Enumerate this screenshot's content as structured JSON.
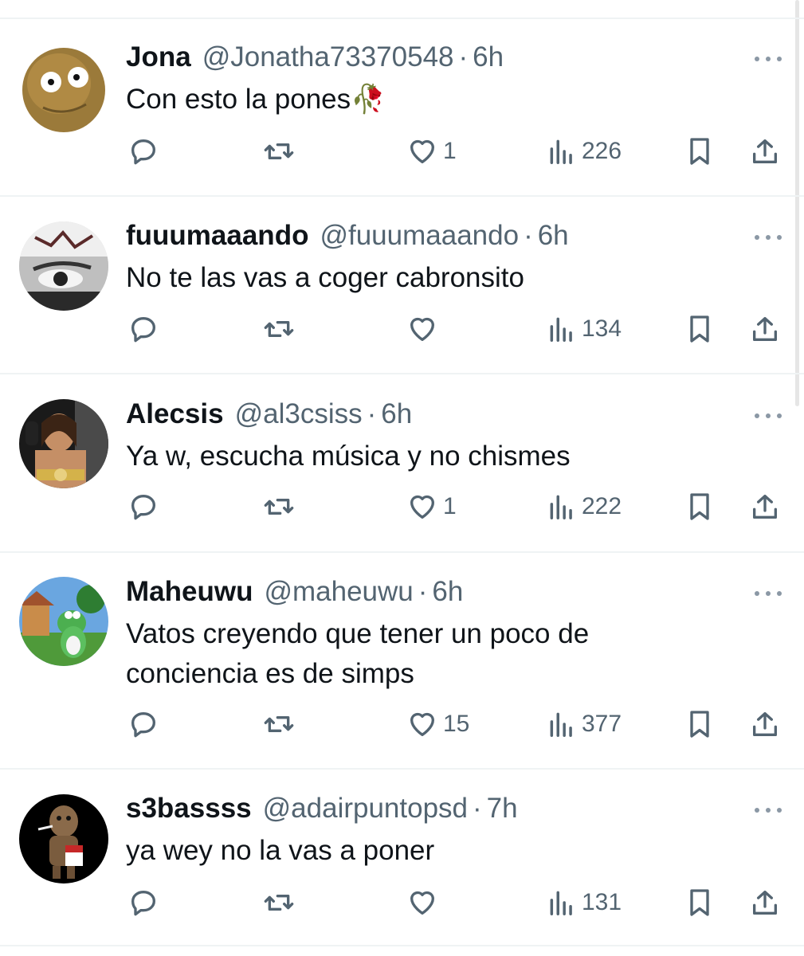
{
  "tweets": [
    {
      "name": "Jona",
      "handle": "@Jonatha73370548",
      "separator": "·",
      "time": "6h",
      "text": "Con esto la pones🥀",
      "likes": "1",
      "views": "226",
      "avatar": "walnut-avatar"
    },
    {
      "name": "fuuumaaando",
      "handle": "@fuuumaaando",
      "separator": "·",
      "time": "6h",
      "text": "No te las vas a coger cabronsito",
      "likes": "",
      "views": "134",
      "avatar": "eye-avatar"
    },
    {
      "name": "Alecsis",
      "handle": "@al3csiss",
      "separator": "·",
      "time": "6h",
      "text": "Ya w, escucha música y no chismes",
      "likes": "1",
      "views": "222",
      "avatar": "wrestler-avatar"
    },
    {
      "name": "Maheuwu",
      "handle": "@maheuwu",
      "separator": "·",
      "time": "6h",
      "text_line1": "Vatos creyendo que tener un poco de",
      "text_line2": "conciencia es de simps",
      "likes": "15",
      "views": "377",
      "avatar": "yoshi-avatar"
    },
    {
      "name": "s3bassss",
      "handle": "@adairpuntopsd",
      "separator": "·",
      "time": "7h",
      "text": "ya wey no la vas a poner",
      "likes": "",
      "views": "131",
      "avatar": "sackboy-avatar"
    }
  ],
  "icons": {
    "reply": "reply-icon",
    "retweet": "retweet-icon",
    "like": "heart-icon",
    "views": "views-icon",
    "bookmark": "bookmark-icon",
    "share": "share-icon",
    "more": "more-icon"
  },
  "colors": {
    "text": "#0f1419",
    "secondary": "#536471",
    "divider": "#eff3f4"
  }
}
